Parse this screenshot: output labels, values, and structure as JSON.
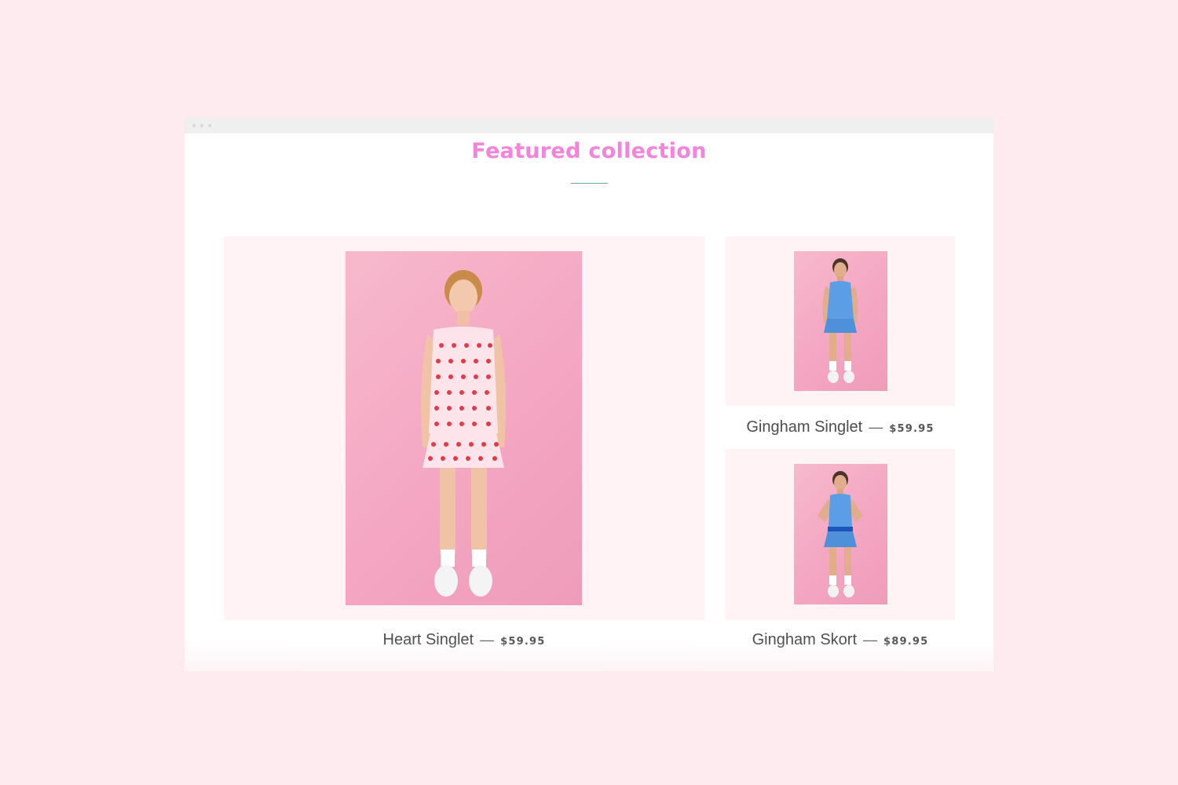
{
  "window": {
    "title_dots": [
      "dot",
      "dot",
      "dot"
    ]
  },
  "section": {
    "heading": "Featured collection",
    "heading_color": "#f284d9",
    "rule_color": "#6aa8a5"
  },
  "products": [
    {
      "name": "Heart Singlet",
      "separator": "—",
      "price": "$59.95",
      "image_icon": "model-heart-print-dress"
    },
    {
      "name": "Gingham Singlet",
      "separator": "—",
      "price": "$59.95",
      "image_icon": "model-blue-singlet"
    },
    {
      "name": "Gingham Skort",
      "separator": "—",
      "price": "$89.95",
      "image_icon": "model-blue-skort"
    }
  ],
  "colors": {
    "page_background": "#fdebef",
    "card_background": "#fff3f5",
    "photo_background": "#f4a6c2"
  }
}
